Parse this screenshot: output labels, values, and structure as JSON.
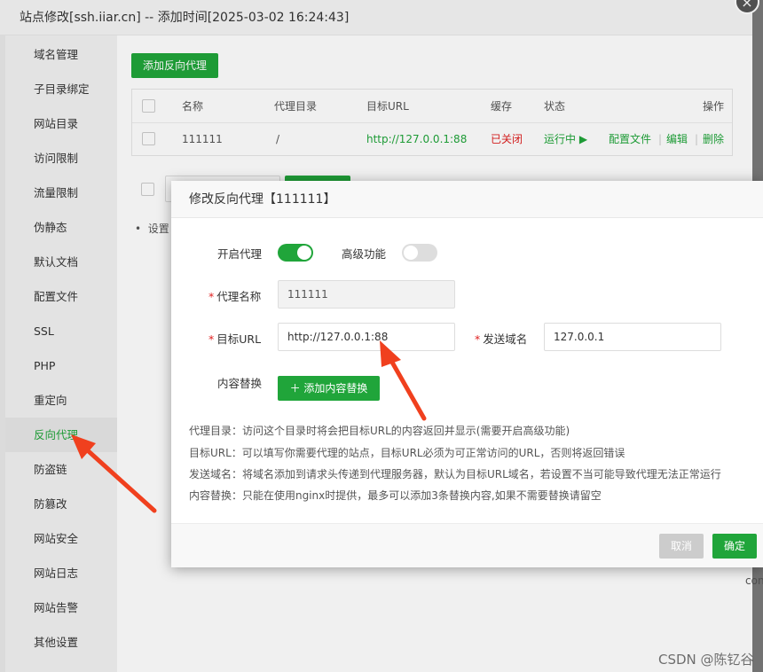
{
  "outer": {
    "title": "站点修改[ssh.iiar.cn] -- 添加时间[2025-03-02 16:24:43]",
    "close_glyph": "×"
  },
  "sidebar": {
    "items": [
      {
        "label": "域名管理"
      },
      {
        "label": "子目录绑定"
      },
      {
        "label": "网站目录"
      },
      {
        "label": "访问限制"
      },
      {
        "label": "流量限制"
      },
      {
        "label": "伪静态"
      },
      {
        "label": "默认文档"
      },
      {
        "label": "配置文件"
      },
      {
        "label": "SSL"
      },
      {
        "label": "PHP"
      },
      {
        "label": "重定向"
      },
      {
        "label": "反向代理",
        "active": true
      },
      {
        "label": "防盗链"
      },
      {
        "label": "防篡改"
      },
      {
        "label": "网站安全"
      },
      {
        "label": "网站日志"
      },
      {
        "label": "网站告警"
      },
      {
        "label": "其他设置"
      }
    ]
  },
  "main": {
    "add_proxy_button": "添加反向代理",
    "table": {
      "headers": {
        "name": "名称",
        "dir": "代理目录",
        "url": "目标URL",
        "cache": "缓存",
        "status": "状态",
        "ops": "操作"
      },
      "row": {
        "name": "111111",
        "dir": "/",
        "url": "http://127.0.0.1:88",
        "cache": "已关闭",
        "status": "运行中",
        "config": "配置文件",
        "edit": "编辑",
        "delete": "删除",
        "sep": "|"
      }
    },
    "bullet_text": "设置",
    "right_edge_text": "con"
  },
  "modal": {
    "title": "修改反向代理【111111】",
    "enable_proxy_label": "开启代理",
    "enable_proxy_on": true,
    "advanced_label": "高级功能",
    "advanced_on": false,
    "required_mark": "*",
    "proxy_name_label": "代理名称",
    "proxy_name_value": "111111",
    "target_url_label": "目标URL",
    "target_url_value": "http://127.0.0.1:88",
    "send_domain_label": "发送域名",
    "send_domain_value": "127.0.0.1",
    "content_replace_label": "内容替换",
    "add_replace_button": "添加内容替换",
    "help": [
      "代理目录：访问这个目录时将会把目标URL的内容返回并显示(需要开启高级功能)",
      "目标URL：可以填写你需要代理的站点，目标URL必须为可正常访问的URL，否则将返回错误",
      "发送域名：将域名添加到请求头传递到代理服务器，默认为目标URL域名，若设置不当可能导致代理无法正常运行",
      "内容替换：只能在使用nginx时提供，最多可以添加3条替换内容,如果不需要替换请留空"
    ],
    "cancel_button": "取消",
    "confirm_button": "确定"
  },
  "watermark": "CSDN @陈钇谷",
  "colors": {
    "accent": "#20a53a",
    "danger": "#e02020",
    "arrow": "#f0401e"
  }
}
